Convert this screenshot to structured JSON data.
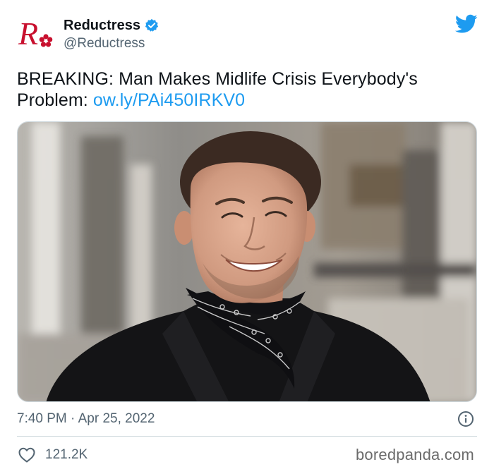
{
  "author": {
    "display_name": "Reductress",
    "handle": "@Reductress",
    "avatar": "reductress-logo",
    "verified": true
  },
  "tweet": {
    "text": "BREAKING: Man Makes Midlife Crisis Everybody's Problem: ",
    "link": "ow.ly/PAi450IRKV0",
    "media": "photo-smiling-man-black-jacket-bandana"
  },
  "meta": {
    "timestamp": "7:40 PM · Apr 25, 2022"
  },
  "engagement": {
    "likes": "121.2K"
  },
  "watermark": "boredpanda.com",
  "icons": {
    "platform": "twitter-bird-icon",
    "verified": "verified-badge-icon",
    "info": "info-icon",
    "like": "heart-icon"
  },
  "colors": {
    "accent": "#1d9bf0",
    "brand_red": "#c8102e",
    "text": "#0f1419",
    "muted": "#536471"
  }
}
